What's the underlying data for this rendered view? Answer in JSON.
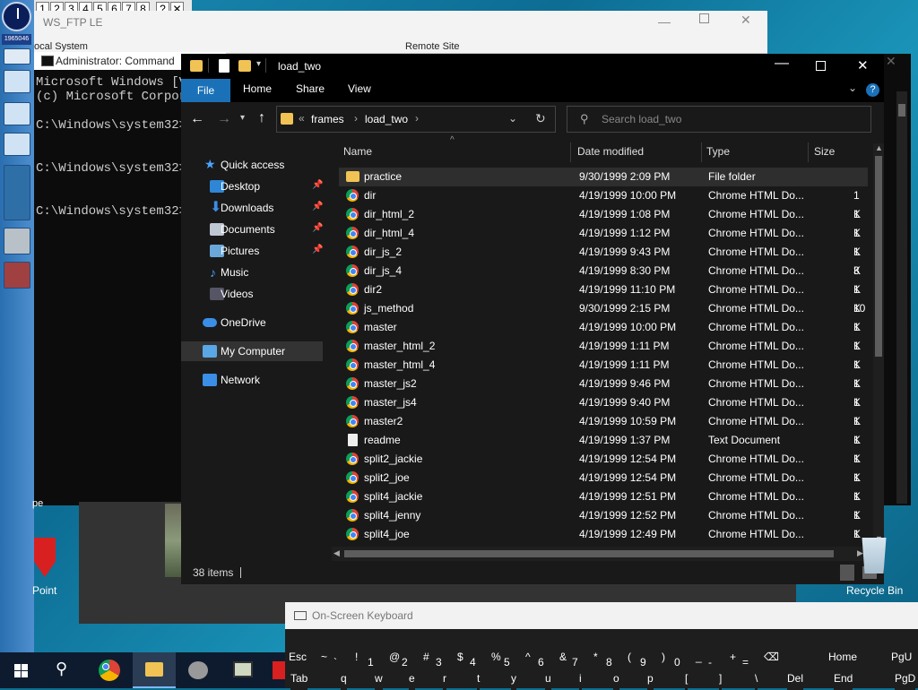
{
  "desktop": {
    "recycle_bin_label": "Recycle Bin",
    "point_label": "Point",
    "pe_label": "pe"
  },
  "leftbar": {
    "date": "1965046"
  },
  "numbar": {
    "items": [
      "1",
      "2",
      "3",
      "4",
      "5",
      "6",
      "7",
      "8",
      "?",
      "✕"
    ]
  },
  "wsftp": {
    "title": "WS_FTP LE",
    "local": "ocal System",
    "remote": "Remote Site"
  },
  "cmd": {
    "title": "Administrator: Command",
    "lines": [
      "Microsoft Windows [V",
      "(c) Microsoft Corpor",
      "C:\\Windows\\system32>",
      "C:\\Windows\\system32>",
      "C:\\Windows\\system32>"
    ]
  },
  "explorer": {
    "title": "load_two",
    "ribbon": {
      "file": "File",
      "home": "Home",
      "share": "Share",
      "view": "View"
    },
    "breadcrumb": {
      "part1": "frames",
      "part2": "load_two"
    },
    "search_placeholder": "Search load_two",
    "nav": {
      "quick_access": "Quick access",
      "desktop": "Desktop",
      "downloads": "Downloads",
      "documents": "Documents",
      "pictures": "Pictures",
      "music": "Music",
      "videos": "Videos",
      "onedrive": "OneDrive",
      "mycomputer": "My Computer",
      "network": "Network"
    },
    "columns": {
      "name": "Name",
      "date": "Date modified",
      "type": "Type",
      "size": "Size"
    },
    "files": [
      {
        "name": "practice",
        "date": "9/30/1999 2:09 PM",
        "type": "File folder",
        "size": "",
        "icon": "folder"
      },
      {
        "name": "dir",
        "date": "4/19/1999 10:00 PM",
        "type": "Chrome HTML Do...",
        "size": "1 K",
        "icon": "chrome"
      },
      {
        "name": "dir_html_2",
        "date": "4/19/1999 1:08 PM",
        "type": "Chrome HTML Do...",
        "size": "1 K",
        "icon": "chrome"
      },
      {
        "name": "dir_html_4",
        "date": "4/19/1999 1:12 PM",
        "type": "Chrome HTML Do...",
        "size": "1 K",
        "icon": "chrome"
      },
      {
        "name": "dir_js_2",
        "date": "4/19/1999 9:43 PM",
        "type": "Chrome HTML Do...",
        "size": "1 K",
        "icon": "chrome"
      },
      {
        "name": "dir_js_4",
        "date": "4/19/1999 8:30 PM",
        "type": "Chrome HTML Do...",
        "size": "3 K",
        "icon": "chrome"
      },
      {
        "name": "dir2",
        "date": "4/19/1999 11:10 PM",
        "type": "Chrome HTML Do...",
        "size": "1 K",
        "icon": "chrome"
      },
      {
        "name": "js_method",
        "date": "9/30/1999 2:15 PM",
        "type": "Chrome HTML Do...",
        "size": "10 K",
        "icon": "chrome"
      },
      {
        "name": "master",
        "date": "4/19/1999 10:00 PM",
        "type": "Chrome HTML Do...",
        "size": "1 K",
        "icon": "chrome"
      },
      {
        "name": "master_html_2",
        "date": "4/19/1999 1:11 PM",
        "type": "Chrome HTML Do...",
        "size": "1 K",
        "icon": "chrome"
      },
      {
        "name": "master_html_4",
        "date": "4/19/1999 1:11 PM",
        "type": "Chrome HTML Do...",
        "size": "1 K",
        "icon": "chrome"
      },
      {
        "name": "master_js2",
        "date": "4/19/1999 9:46 PM",
        "type": "Chrome HTML Do...",
        "size": "1 K",
        "icon": "chrome"
      },
      {
        "name": "master_js4",
        "date": "4/19/1999 9:40 PM",
        "type": "Chrome HTML Do...",
        "size": "1 K",
        "icon": "chrome"
      },
      {
        "name": "master2",
        "date": "4/19/1999 10:59 PM",
        "type": "Chrome HTML Do...",
        "size": "1 K",
        "icon": "chrome"
      },
      {
        "name": "readme",
        "date": "4/19/1999 1:37 PM",
        "type": "Text Document",
        "size": "1 K",
        "icon": "doc"
      },
      {
        "name": "split2_jackie",
        "date": "4/19/1999 12:54 PM",
        "type": "Chrome HTML Do...",
        "size": "1 K",
        "icon": "chrome"
      },
      {
        "name": "split2_joe",
        "date": "4/19/1999 12:54 PM",
        "type": "Chrome HTML Do...",
        "size": "1 K",
        "icon": "chrome"
      },
      {
        "name": "split4_jackie",
        "date": "4/19/1999 12:51 PM",
        "type": "Chrome HTML Do...",
        "size": "1 K",
        "icon": "chrome"
      },
      {
        "name": "split4_jenny",
        "date": "4/19/1999 12:52 PM",
        "type": "Chrome HTML Do...",
        "size": "1 K",
        "icon": "chrome"
      },
      {
        "name": "split4_joe",
        "date": "4/19/1999 12:49 PM",
        "type": "Chrome HTML Do...",
        "size": "1 K",
        "icon": "chrome"
      }
    ],
    "status": "38 items"
  },
  "osk": {
    "title": "On-Screen Keyboard",
    "row1": [
      "Esc",
      "~",
      "!",
      "@",
      "#",
      "$",
      "%",
      "^",
      "&",
      "*",
      "(",
      ")",
      "_",
      "+",
      "⌫",
      "Home",
      "PgU"
    ],
    "row1b": [
      "",
      "`",
      "1",
      "2",
      "3",
      "4",
      "5",
      "6",
      "7",
      "8",
      "9",
      "0",
      "-",
      "="
    ],
    "row2": [
      "Tab",
      "q",
      "w",
      "e",
      "r",
      "t",
      "y",
      "u",
      "i",
      "o",
      "p",
      "[",
      "]",
      "\\",
      "Del",
      "End",
      "PgD"
    ]
  },
  "colors": {
    "accent": "#1a71b8",
    "explorer_bg": "#191919",
    "selection": "#333333"
  }
}
